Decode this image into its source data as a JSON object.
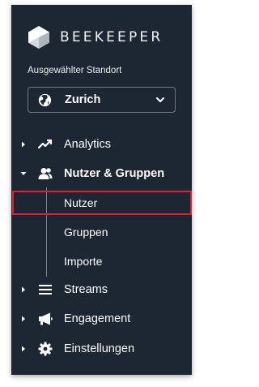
{
  "brand": {
    "name": "BEEKEEPER"
  },
  "location": {
    "label": "Ausgewählter Standort",
    "selected": "Zurich"
  },
  "nav": {
    "analytics": {
      "label": "Analytics",
      "icon": "chart-line-icon",
      "expanded": false
    },
    "users_groups": {
      "label": "Nutzer & Gruppen",
      "icon": "users-icon",
      "expanded": true,
      "children": [
        {
          "label": "Nutzer",
          "highlighted": true
        },
        {
          "label": "Gruppen"
        },
        {
          "label": "Importe"
        }
      ]
    },
    "streams": {
      "label": "Streams",
      "icon": "menu-lines-icon",
      "expanded": false
    },
    "engagement": {
      "label": "Engagement",
      "icon": "megaphone-icon",
      "expanded": false
    },
    "settings": {
      "label": "Einstellungen",
      "icon": "gear-icon",
      "expanded": false
    }
  },
  "colors": {
    "sidebar_bg": "#1c2733",
    "highlight": "#e0202e",
    "text": "#ffffff"
  }
}
